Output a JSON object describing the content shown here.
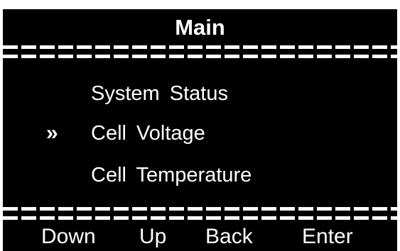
{
  "screen": {
    "title": "Main",
    "cursor_glyph": "»",
    "menu_items": [
      {
        "label": "System Status",
        "selected": false
      },
      {
        "label": "Cell Voltage",
        "selected": true
      },
      {
        "label": "Cell Temperature",
        "selected": false
      }
    ],
    "softkeys": {
      "down": "Down",
      "up": "Up",
      "back": "Back",
      "enter": "Enter"
    }
  },
  "colors": {
    "background": "#000000",
    "foreground": "#ffffff"
  }
}
